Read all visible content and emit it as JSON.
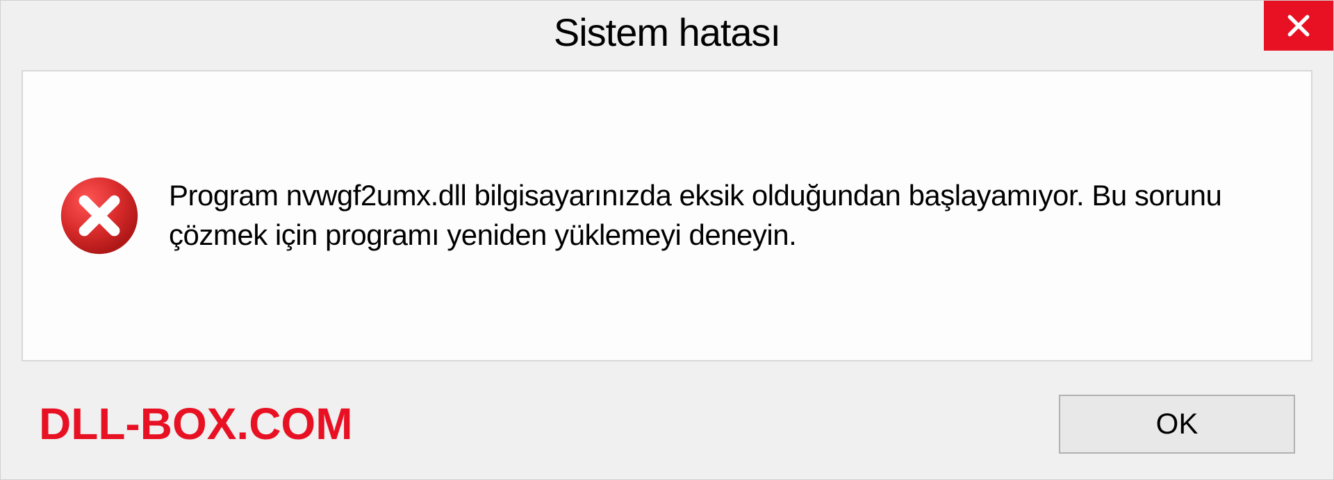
{
  "dialog": {
    "title": "Sistem hatası",
    "message": "Program nvwgf2umx.dll bilgisayarınızda eksik olduğundan başlayamıyor. Bu sorunu çözmek için programı yeniden yüklemeyi deneyin.",
    "ok_label": "OK"
  },
  "watermark": "DLL-BOX.COM",
  "colors": {
    "close_button": "#e81123",
    "error_icon": "#d92b2b",
    "watermark": "#e81123"
  }
}
